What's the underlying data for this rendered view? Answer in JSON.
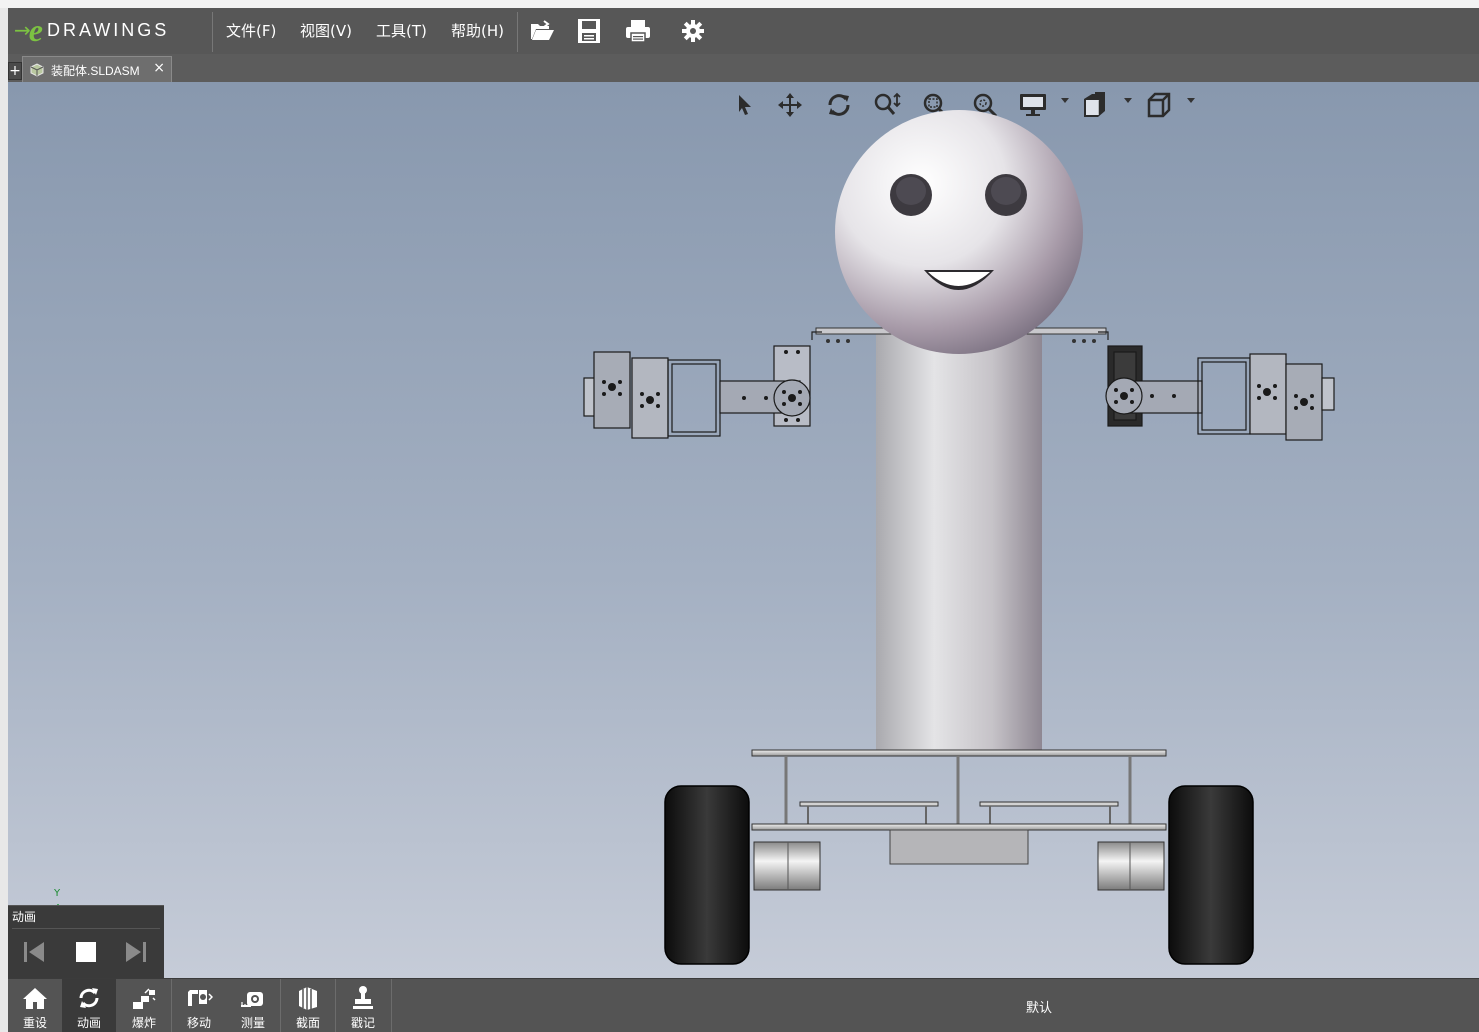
{
  "app": {
    "logo_text": "DRAWINGS",
    "logo_letter": "e",
    "brand_color": "#7cc242"
  },
  "menu": {
    "file": "文件(F)",
    "view": "视图(V)",
    "tools": "工具(T)",
    "help": "帮助(H)"
  },
  "toolbar_icons": [
    "open-icon",
    "save-icon",
    "print-icon",
    "settings-icon"
  ],
  "tab": {
    "plus": "+",
    "label": "装配体.SLDASM",
    "close": "×"
  },
  "hud_icons": [
    "select-icon",
    "pan-icon",
    "rotate-icon",
    "zoom-icon",
    "zoom-to-area-icon",
    "zoom-to-fit-icon",
    "display-style-icon",
    "view-orientation-icon",
    "standard-views-icon"
  ],
  "triad": {
    "y_label": "Y"
  },
  "animation": {
    "title": "动画"
  },
  "bottom": {
    "reset": "重设",
    "animate": "动画",
    "explode": "爆炸",
    "move": "移动",
    "measure": "测量",
    "section": "截面",
    "stamp": "戳记",
    "configuration": "默认"
  },
  "colors": {
    "menubar": "#575757",
    "viewport_top": "#8898ae",
    "viewport_bottom": "#c6ccd8"
  }
}
